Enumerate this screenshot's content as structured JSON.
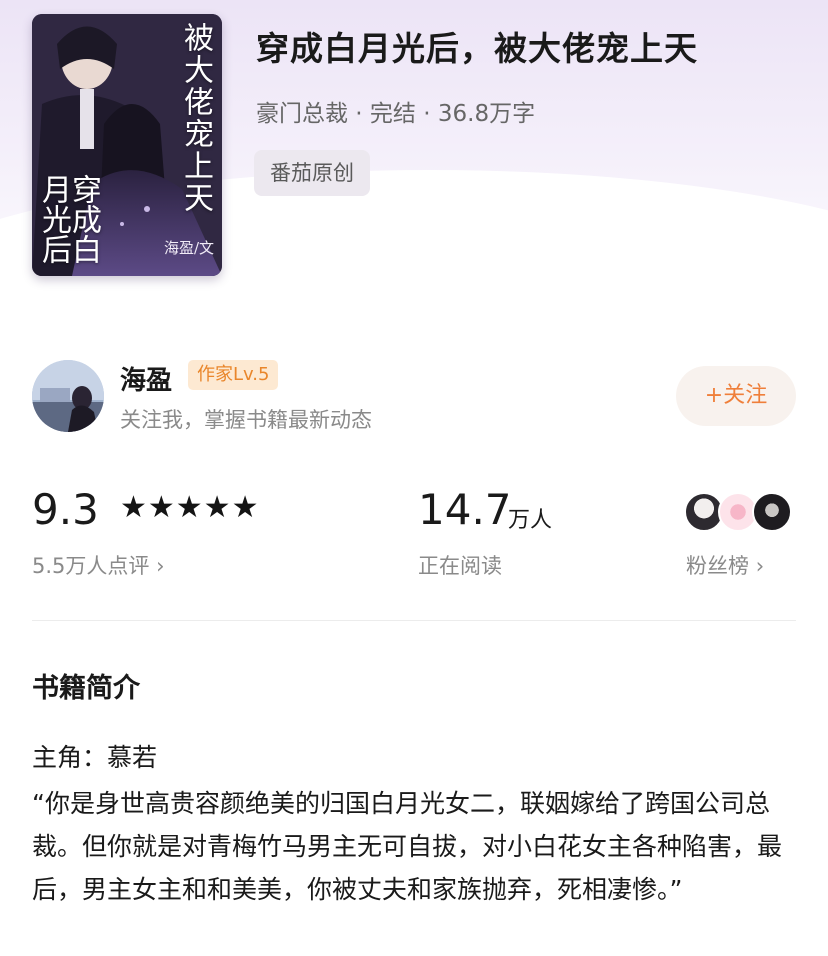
{
  "book": {
    "title": "穿成白月光后，被大佬宠上天",
    "meta": "豪门总裁 · 完结 · 36.8万字",
    "tag": "番茄原创",
    "cover": {
      "title_top": "被大佬宠上天",
      "title_bottom": "穿成白月光后",
      "author_credit": "海盈/文"
    }
  },
  "author": {
    "name": "海盈",
    "level_badge": "作家Lv.5",
    "description": "关注我，掌握书籍最新动态",
    "follow_label": "+关注"
  },
  "stats": {
    "rating": "9.3",
    "stars": "★★★★★",
    "reviews_label": "5.5万人点评",
    "readers_value": "14.7",
    "readers_unit": "万人",
    "readers_label": "正在阅读",
    "fans_label": "粉丝榜"
  },
  "intro": {
    "section_title": "书籍简介",
    "protagonist": "主角：慕若",
    "text": "“你是身世高贵容颜绝美的归国白月光女二，联姻嫁给了跨国公司总裁。但你就是对青梅竹马男主无可自拔，对小白花女主各种陷害，最后，男主女主和和美美，你被丈夫和家族抛弃，死相凄惨。”"
  },
  "colors": {
    "accent_orange": "#ef7f3a",
    "badge_bg": "#fde9d2",
    "hero_bg": "#ece4f6"
  },
  "icons": {
    "chevron": "chevron-right-icon",
    "star": "star-icon"
  }
}
